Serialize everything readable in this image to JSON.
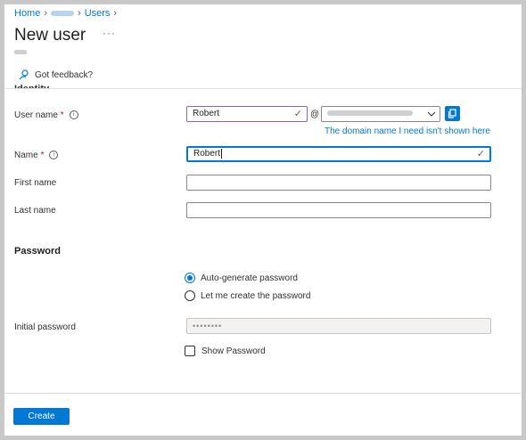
{
  "breadcrumb": {
    "home": "Home",
    "middle": "",
    "users": "Users"
  },
  "page": {
    "title": "New user",
    "more": "···"
  },
  "feedback": {
    "label": "Got feedback?"
  },
  "identity": {
    "heading": "Identity",
    "user_name": {
      "label": "User name",
      "required_mark": "*",
      "value": "Robert",
      "at": "@",
      "domain_hint": "The domain name I need isn't shown here"
    },
    "name": {
      "label": "Name",
      "required_mark": "*",
      "value": "Robert"
    },
    "first_name": {
      "label": "First name",
      "value": ""
    },
    "last_name": {
      "label": "Last name",
      "value": ""
    }
  },
  "password": {
    "heading": "Password",
    "options": [
      {
        "label": "Auto-generate password",
        "selected": true
      },
      {
        "label": "Let me create the password",
        "selected": false
      }
    ],
    "initial_label": "Initial password",
    "initial_value": "••••••••",
    "show_label": "Show Password",
    "show_checked": false
  },
  "footer": {
    "create_label": "Create"
  },
  "colors": {
    "accent": "#0078d4",
    "purple_border": "#8764b8",
    "required": "#a4262c"
  },
  "icons": [
    "chevron-right-icon",
    "ellipsis-icon",
    "feedback-icon",
    "info-icon",
    "checkmark-icon",
    "chevron-down-icon",
    "copy-icon"
  ]
}
